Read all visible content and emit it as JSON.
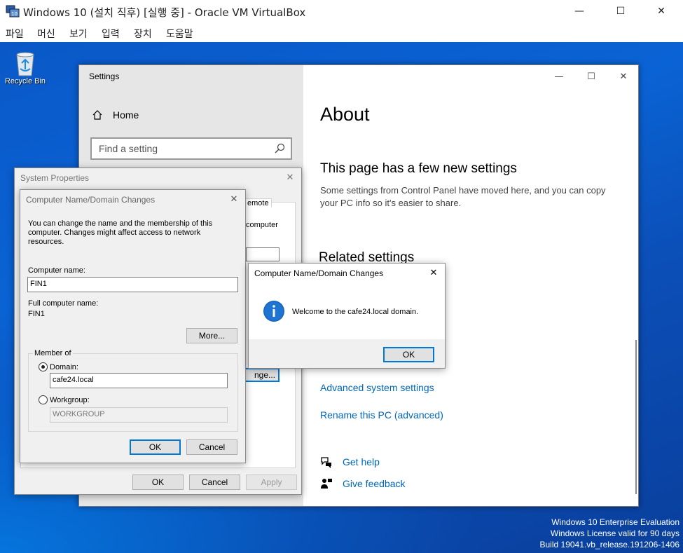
{
  "host": {
    "title": "Windows 10 (설치 직후) [실행 중] - Oracle VM VirtualBox",
    "menu": [
      "파일",
      "머신",
      "보기",
      "입력",
      "장치",
      "도움말"
    ],
    "controls": {
      "minimize": "—",
      "maximize": "☐",
      "close": "✕"
    }
  },
  "desktop": {
    "recycle_bin_label": "Recycle Bin",
    "watermark": {
      "line1": "Windows 10 Enterprise Evaluation",
      "line2": "Windows License valid for 90 days",
      "line3": "Build 19041.vb_release.191206-1406"
    }
  },
  "settings": {
    "window_title": "Settings",
    "home_label": "Home",
    "search_placeholder": "Find a setting",
    "page_title": "About",
    "new_settings_heading": "This page has a few new settings",
    "new_settings_text": "Some settings from Control Panel have moved here, and you can copy your PC info so it's easier to share.",
    "related_heading": "Related settings",
    "links": {
      "advanced": "Advanced system settings",
      "rename": "Rename this PC (advanced)",
      "get_help": "Get help",
      "give_feedback": "Give feedback"
    }
  },
  "system_properties": {
    "title": "System Properties",
    "tab_fragment": "emote",
    "text_fragment": "computer",
    "change_btn_fragment": "nge...",
    "buttons": {
      "ok": "OK",
      "cancel": "Cancel",
      "apply": "Apply"
    }
  },
  "domain_changes": {
    "title": "Computer Name/Domain Changes",
    "description": "You can change the name and the membership of this computer. Changes might affect access to network resources.",
    "computer_name_label": "Computer name:",
    "computer_name_value": "FIN1",
    "full_name_label": "Full computer name:",
    "full_name_value": "FIN1",
    "more_button": "More...",
    "member_of_label": "Member of",
    "domain_label": "Domain:",
    "domain_value": "cafe24.local",
    "workgroup_label": "Workgroup:",
    "workgroup_value": "WORKGROUP",
    "ok": "OK",
    "cancel": "Cancel"
  },
  "welcome_dialog": {
    "title": "Computer Name/Domain Changes",
    "message": "Welcome to the cafe24.local domain.",
    "ok": "OK"
  },
  "colors": {
    "link": "#0067b8",
    "accent": "#0078d7",
    "desktop": "#0a58c8"
  }
}
